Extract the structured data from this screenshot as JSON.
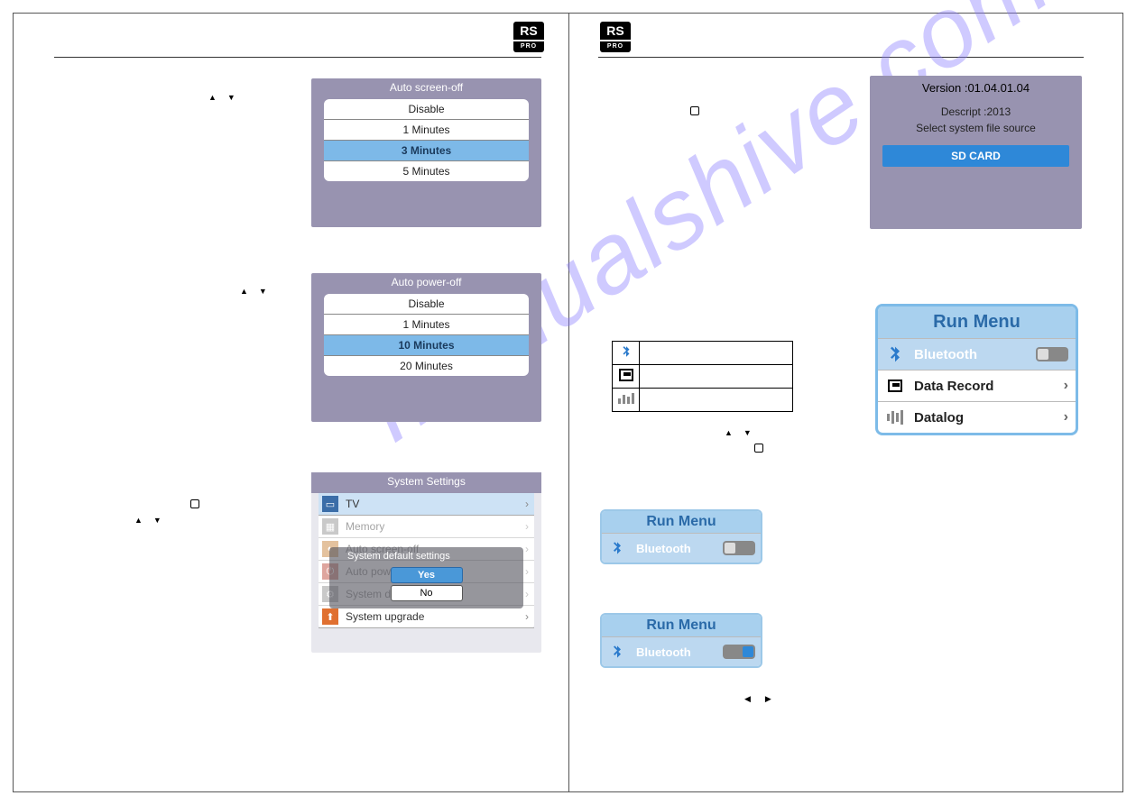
{
  "logo": {
    "top": "RS",
    "bot": "PRO"
  },
  "watermark": "manualshive.com",
  "left_page": {
    "screen1": {
      "title": "Auto screen-off",
      "options": [
        "Disable",
        "1 Minutes",
        "3 Minutes",
        "5 Minutes"
      ],
      "selected_index": 2
    },
    "screen2": {
      "title": "Auto power-off",
      "options": [
        "Disable",
        "1 Minutes",
        "10 Minutes",
        "20 Minutes"
      ],
      "selected_index": 2
    },
    "screen3": {
      "title": "System Settings",
      "items": [
        "TV",
        "Memory",
        "Auto screen-off",
        "Auto powr-off",
        "System default settings",
        "System upgrade"
      ],
      "dialog": {
        "head": "System default settings",
        "yes": "Yes",
        "no": "No"
      }
    }
  },
  "right_page": {
    "version_box": {
      "title": "Version :01.04.01.04",
      "descript": "Descript   :2013",
      "prompt": "Select system file source",
      "button": "SD CARD"
    },
    "run_menu": {
      "title": "Run Menu",
      "items": [
        {
          "label": "Bluetooth",
          "kind": "toggle"
        },
        {
          "label": "Data Record",
          "kind": "nav"
        },
        {
          "label": "Datalog",
          "kind": "nav"
        }
      ]
    },
    "run_small_1": {
      "title": "Run Menu",
      "label": "Bluetooth",
      "state": "off"
    },
    "run_small_2": {
      "title": "Run Menu",
      "label": "Bluetooth",
      "state": "on"
    }
  }
}
